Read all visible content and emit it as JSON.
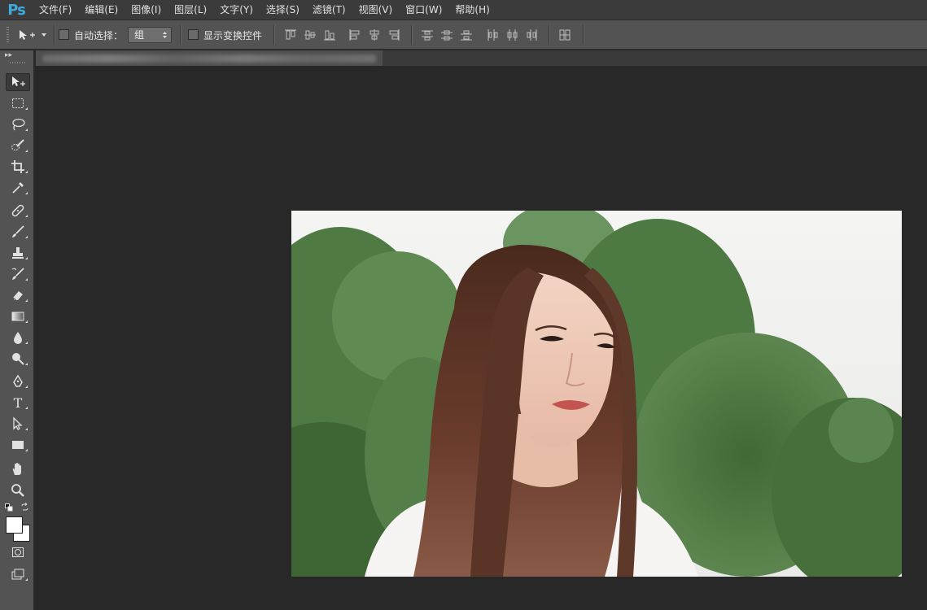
{
  "app": {
    "logo": "Ps"
  },
  "menu": [
    {
      "label": "文件(F)"
    },
    {
      "label": "编辑(E)"
    },
    {
      "label": "图像(I)"
    },
    {
      "label": "图层(L)"
    },
    {
      "label": "文字(Y)"
    },
    {
      "label": "选择(S)"
    },
    {
      "label": "滤镜(T)"
    },
    {
      "label": "视图(V)"
    },
    {
      "label": "窗口(W)"
    },
    {
      "label": "帮助(H)"
    }
  ],
  "options_bar": {
    "auto_select_label": "自动选择：",
    "auto_select_checked": false,
    "auto_select_mode": "组",
    "show_transform_label": "显示变换控件",
    "show_transform_checked": false
  },
  "tools": [
    {
      "name": "move-tool",
      "icon": "move-icon",
      "active": true
    },
    {
      "name": "marquee-tool",
      "icon": "rectangular-marquee-icon"
    },
    {
      "name": "lasso-tool",
      "icon": "lasso-icon"
    },
    {
      "name": "quick-selection-tool",
      "icon": "quick-selection-icon"
    },
    {
      "name": "crop-tool",
      "icon": "crop-icon"
    },
    {
      "name": "eyedropper-tool",
      "icon": "eyedropper-icon"
    },
    {
      "name": "healing-brush-tool",
      "icon": "bandage-icon"
    },
    {
      "name": "brush-tool",
      "icon": "brush-icon"
    },
    {
      "name": "clone-stamp-tool",
      "icon": "stamp-icon"
    },
    {
      "name": "history-brush-tool",
      "icon": "history-brush-icon"
    },
    {
      "name": "eraser-tool",
      "icon": "eraser-icon"
    },
    {
      "name": "gradient-tool",
      "icon": "gradient-icon"
    },
    {
      "name": "blur-tool",
      "icon": "drop-icon"
    },
    {
      "name": "dodge-tool",
      "icon": "dodge-icon"
    },
    {
      "name": "pen-tool",
      "icon": "pen-icon"
    },
    {
      "name": "type-tool",
      "icon": "type-icon",
      "glyph": "T"
    },
    {
      "name": "path-selection-tool",
      "icon": "path-selection-icon"
    },
    {
      "name": "shape-tool",
      "icon": "rectangle-icon"
    },
    {
      "name": "hand-tool",
      "icon": "hand-icon"
    },
    {
      "name": "zoom-tool",
      "icon": "zoom-icon"
    }
  ],
  "colors": {
    "foreground": "#ffffff",
    "background": "#ffffff",
    "accent": "#3fa9e0"
  },
  "canvas": {
    "image_description_icon": "photo-icon"
  }
}
